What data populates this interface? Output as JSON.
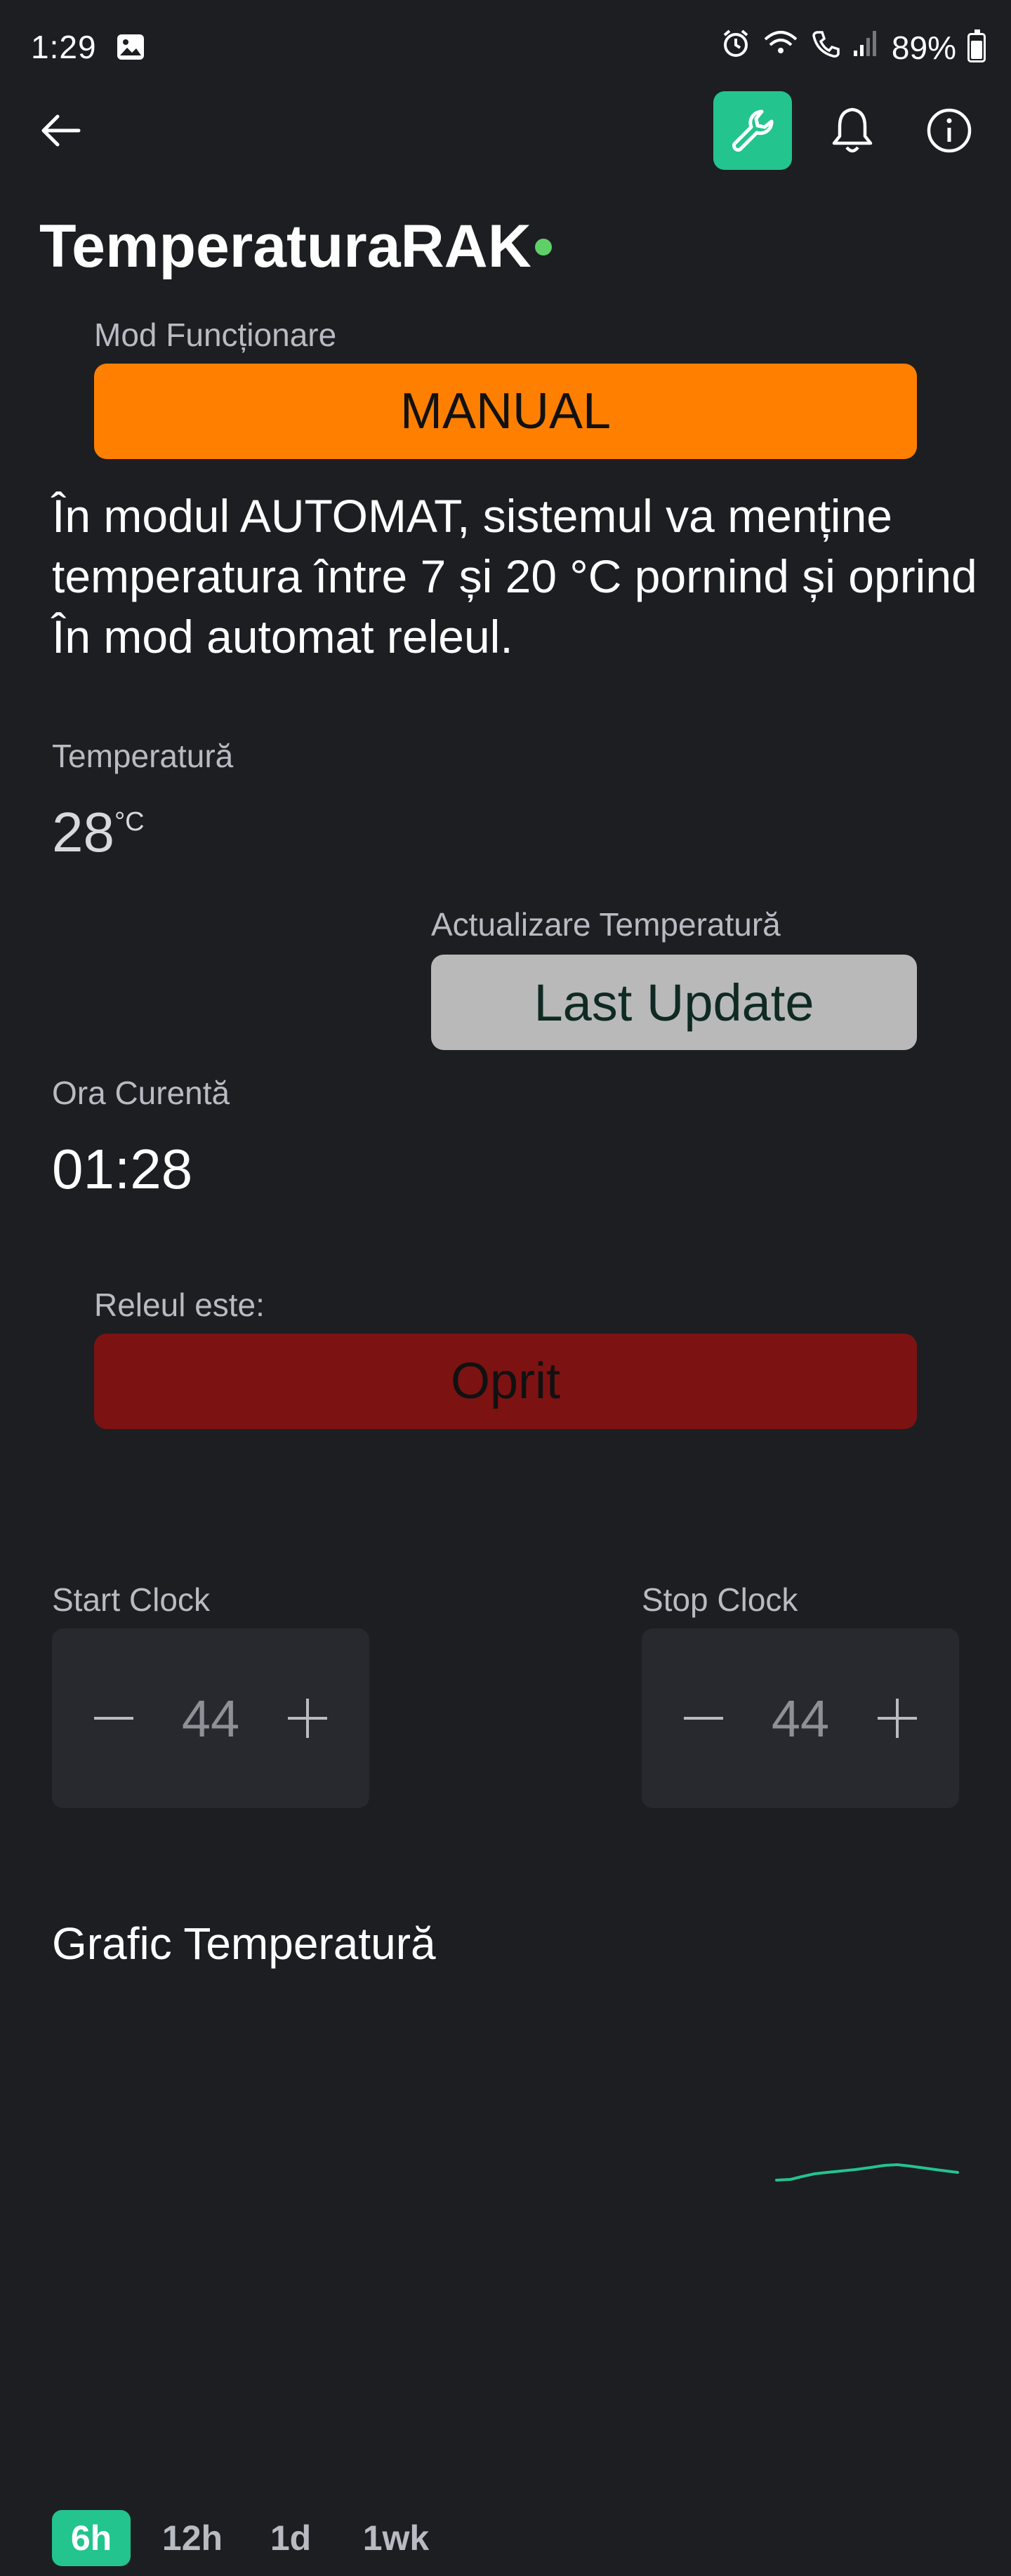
{
  "status_bar": {
    "time": "1:29",
    "battery": "89%",
    "icons": [
      "gallery-icon",
      "alarm-icon",
      "wifi-icon",
      "call-icon",
      "signal-icon",
      "battery-icon"
    ]
  },
  "top_bar": {
    "back_icon": "arrow-left-icon",
    "tools_icon": "wrench-icon",
    "notifications_icon": "bell-icon",
    "info_icon": "info-icon"
  },
  "device": {
    "name": "TemperaturaRAK",
    "status_color": "#5fd068"
  },
  "mode": {
    "label": "Mod Funcționare",
    "button": "MANUAL",
    "color": "#ff8000"
  },
  "description": "În modul AUTOMAT, sistemul va menține temperatura între 7 și 20 °C pornind și oprind În mod automat releul.",
  "temperature": {
    "label": "Temperatură",
    "value": "28",
    "unit": "°C"
  },
  "update": {
    "label": "Actualizare Temperatură",
    "button": "Last Update",
    "color": "#b9b9ba"
  },
  "clock": {
    "label": "Ora Curentă",
    "value": "01:28"
  },
  "relay": {
    "label": "Releul este:",
    "button": "Oprit",
    "color": "#7d1212"
  },
  "start_clock": {
    "label": "Start Clock",
    "value": "44"
  },
  "stop_clock": {
    "label": "Stop Clock",
    "value": "44"
  },
  "chart_section": {
    "title": "Grafic Temperatură",
    "line_color": "#23c48e",
    "ranges": [
      "6h",
      "12h",
      "1d",
      "1wk"
    ],
    "active_range": "6h"
  }
}
